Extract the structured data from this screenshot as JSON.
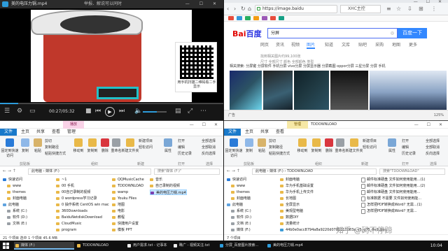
{
  "video_player": {
    "title": "美的电压力锅.mp4",
    "hint": "举报、解说可以同时",
    "qr_text": "用手机扫描二维码看二手显示",
    "time": "00:27/05:32",
    "progress": 0.08,
    "volume": 0.6
  },
  "browser": {
    "url": "https://image.baidu",
    "search_box": "XHC主控",
    "query": "分屏",
    "search_button": "百度一下",
    "logo_left": "Bai",
    "logo_right": "百度",
    "categories": [
      "网页",
      "资讯",
      "视频",
      "图片",
      "知道",
      "文库",
      "贴吧",
      "采购",
      "地图",
      "更多"
    ],
    "active_category": "图片",
    "filters": "找到相关图片约99,100张",
    "filters2": "尺寸 全部尺寸   颜色 全部颜色   类型",
    "related": "相关搜索: 分屏键 分屏软件 手机分屏 vivo分屏 分屏显示器 分屏截图 oppor分屏 三星分屏 分屏 手机",
    "zoom": "125%",
    "status": "广告"
  },
  "explorer_left": {
    "context_tab": "播放",
    "menus": [
      "文件",
      "主页",
      "共享",
      "查看",
      "管理"
    ],
    "ribbon": {
      "pin": "固定到快速访问",
      "copy": "复制",
      "paste": "粘贴",
      "cut": "剪切",
      "copy_path": "复制路径",
      "paste_shortcut": "粘贴快捷方式",
      "move_to": "移动到",
      "copy_to": "复制到",
      "delete": "删除",
      "rename": "重命名",
      "new_folder": "新建文件夹",
      "new_item": "新建项目",
      "easy_access": "轻松访问",
      "properties": "属性",
      "open": "打开",
      "edit": "编辑",
      "history": "历史记录",
      "select_all": "全部选择",
      "select_none": "全部取消",
      "invert": "反向选择",
      "group_clipboard": "剪贴板",
      "group_organize": "组织",
      "group_new": "新建",
      "group_open": "打开",
      "group_select": "选择"
    },
    "address": "此电脑 › 媒体 (F:)",
    "search_placeholder": "搜索\"媒体 (F:)\"",
    "nav": [
      "快速访问",
      "www",
      "themes",
      "封面电脑",
      "此电脑",
      "系统 (C:)",
      "软件 (D:)",
      "文档 (E:)"
    ],
    "files_col1": [
      "~1",
      "00 手机",
      "00自己录制的视频",
      "0 wordpress学习记录",
      "0 操作系统 CentOS win mac",
      "360Downloads",
      "BaiduNetdiskDownload",
      "CloudMusic",
      "program"
    ],
    "files_col2": [
      "QQMusicCache",
      "TDDOWNLOAD",
      "wamp",
      "Youku Files",
      "地图",
      "电影",
      "教程",
      "快捷用户设置",
      "模板 PPT"
    ],
    "files_col3": [
      "音乐",
      "自己录制的视频",
      "美的电压力锅.mp4"
    ],
    "status": "21 个项目   选中 1 个项目  45.6 MB"
  },
  "explorer_right": {
    "context_tab": "管理",
    "title": "TDDOWNLOAD",
    "menus": [
      "文件",
      "主页",
      "共享",
      "查看"
    ],
    "address": "此电脑 › 媒体 (F:) › TDDOWNLOAD",
    "search_placeholder": "搜索\"TDDOWNLOAD\"",
    "nav": [
      "快速访问",
      "www",
      "themes",
      "封面电脑",
      "此电脑",
      "系统 (C:)",
      "软件 (D:)",
      "文档 (E:)",
      "媒体 (F:)"
    ],
    "files_left": [
      "封面电脑",
      "华为手机基础设置",
      "华为手机上传文件",
      "长地图",
      "全屏显示",
      "美观型电脑",
      "数据DIY",
      "流量统计",
      "44b0e0acc8794a8a9220d0781112083a_c5_q75_0x0.jpeg"
    ],
    "files_right": [
      "邮件标准硬盘 文件如何使用能用...(1)",
      "邮件标准硬盘 文件如何使用能用...(2)",
      "邮件标准硬盘 文件如何使用能用...",
      "标准数据 不需要 文件如何使用能...",
      "怎样把PDF转换成Word? 无需...(1)",
      "怎样把PDF转换成Word? 无需..."
    ],
    "status": "7 个项目",
    "watermark": "知乎 @码不停蹄"
  },
  "taskbar": {
    "items": [
      {
        "label": "媒体 (F:)",
        "active": true
      },
      {
        "label": "TDDOWNLOAD",
        "active": false
      },
      {
        "label": "用户需求.txt - 记事本",
        "active": false
      },
      {
        "label": "瞧广 - 视频关注.txt",
        "active": false
      },
      {
        "label": "分屏_百度图片搜索...",
        "active": false
      },
      {
        "label": "美的电压力锅.mp4",
        "active": false
      }
    ],
    "time": "10:04",
    "date": "2017/8/1"
  }
}
